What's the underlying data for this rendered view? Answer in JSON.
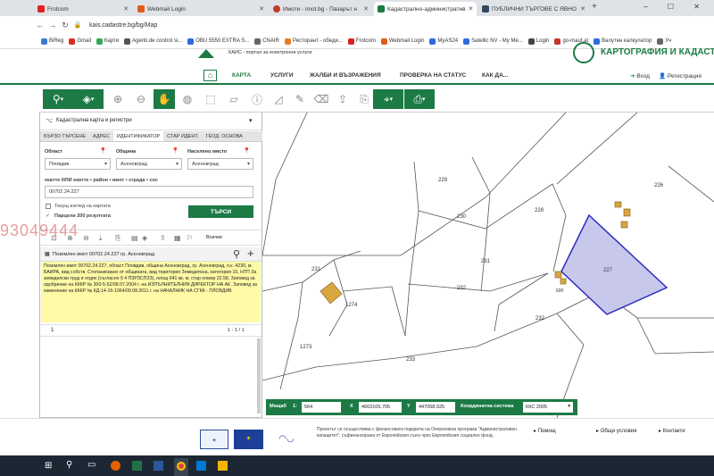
{
  "browser": {
    "tabs": [
      {
        "label": "Frotcom",
        "color": "#e02020"
      },
      {
        "label": "Webmail Login",
        "color": "#e05a1a"
      },
      {
        "label": "Имоти - imot.bg - Пазарът н",
        "color": "#c0392b"
      },
      {
        "label": "Кадастрално-административ",
        "color": "#1c7a45"
      },
      {
        "label": "ПУБЛИЧНИ ТЪРГОВЕ С ЯВНО",
        "color": "#34495e"
      }
    ],
    "url": "kais.cadastre.bg/bg/Map",
    "window_controls": "– ☐ ✕",
    "bookmarks": [
      {
        "label": "BiReg",
        "color": "#3b7bd4"
      },
      {
        "label": "Gmail",
        "color": "#d93025"
      },
      {
        "label": "Карти",
        "color": "#34a853"
      },
      {
        "label": "Agenti.de control si...",
        "color": "#555555"
      },
      {
        "label": "OBU 5550 EXTRA S...",
        "color": "#2d6cdf"
      },
      {
        "label": "CNAIR",
        "color": "#666666"
      },
      {
        "label": "Ресторант - обеди...",
        "color": "#e67e22"
      },
      {
        "label": "Frotcom",
        "color": "#e02020"
      },
      {
        "label": "Webmail Login",
        "color": "#e05a1a"
      },
      {
        "label": "MyAS24",
        "color": "#2d6cdf"
      },
      {
        "label": "Satellic NV - My Me...",
        "color": "#2d6cdf"
      },
      {
        "label": "Login",
        "color": "#444444"
      },
      {
        "label": "go-maut.at",
        "color": "#c0392b"
      },
      {
        "label": "Валутен калкулатор",
        "color": "#2d6cdf"
      },
      {
        "label": "Уч",
        "color": "#666666"
      }
    ]
  },
  "site": {
    "subtitle": "КАИС - портал за електронни услуги",
    "brand": "КАРТОГРАФИЯ И КАДАСТЪ",
    "menu": [
      "КАРТА",
      "УСЛУГИ",
      "ЖАЛБИ И ВЪЗРАЖЕНИЯ",
      "ПРОВЕРКА НА СТАТУС",
      "КАК ДА..."
    ],
    "login": "Вход",
    "register": "Регистрация"
  },
  "panel": {
    "title": "Кадастрална карта и регистри",
    "tabs": [
      "БЪРЗО ТЪРСЕНЕ",
      "АДРЕС",
      "ИДЕНТИФИКАТОР",
      "СТАР ИДЕНТ.",
      "ГЕОД. ОСНОВА"
    ],
    "fields": {
      "region_label": "Област",
      "region_value": "Пловдив",
      "municipality_label": "Община",
      "municipality_value": "Асеновград",
      "settlement_label": "Населено място",
      "settlement_value": "Асеновград"
    },
    "id_hint": "екатте ИЛИ екатте • район • имот • сграда • сос",
    "id_value": "00702.24.227",
    "current_view_label": "Текущ изглед на картата",
    "results_label": "Парцели 200 резултата",
    "search_button": "ТЪРСИ",
    "all_label": "Всички",
    "result_header": "Поземлен имот 00702.24.227 гр. Асеновград",
    "result_text": "Поземлен имот 00702.24.227, област Пловдив, община Асеновград, гр. Асеновград, п.к. 4230, м. БАИРА, вид собств. Стопанисвано от общината, вид територия Земеделска, категория 10, НТП За земеделски труд и отдих (съгласно § 4 ПЗРЗСПЗЗ), площ 641 кв. м, стар номер 22.58, Заповед за одобрение на КККР № 300-5-52/08.07.2004 г. на ИЗПЪЛНИТЕЛНИЯ ДИРЕКТОР НА АК. Заповед за изменение на КККР № КД-14-16-1064/09.08.2011 г. на НАЧАЛНИК НА СГКК - ПЛОВДИВ",
    "page": "1",
    "pager": "1 - 1 / 1"
  },
  "map": {
    "parcels": [
      "229",
      "226",
      "230",
      "228",
      "231",
      "227",
      "232",
      "232",
      "600",
      "231",
      "1274",
      "1273",
      "233"
    ],
    "watermark": "93049444"
  },
  "status": {
    "scale_label": "Мащаб",
    "scale_prefix": "1:",
    "scale_value": "564",
    "x_label": "X",
    "x_value": "4663105.705",
    "y_label": "Y",
    "y_value": "447068.925",
    "crs_label": "Координатна система",
    "crs_value": "ККС 2005"
  },
  "footer": {
    "text": "Проектът се осъществява с финансовата подкрепа на Оперативна програма \"Административен капацитет\", съфинансирана от Европейския съюз чрез Европейския социален фонд.",
    "links": [
      "Помощ",
      "Общи условия",
      "Контакти"
    ]
  },
  "colors": {
    "brand_green": "#1c7a45",
    "highlight": "#c8c8ec",
    "info_bg": "#fffaa5",
    "building": "#d9a640"
  }
}
